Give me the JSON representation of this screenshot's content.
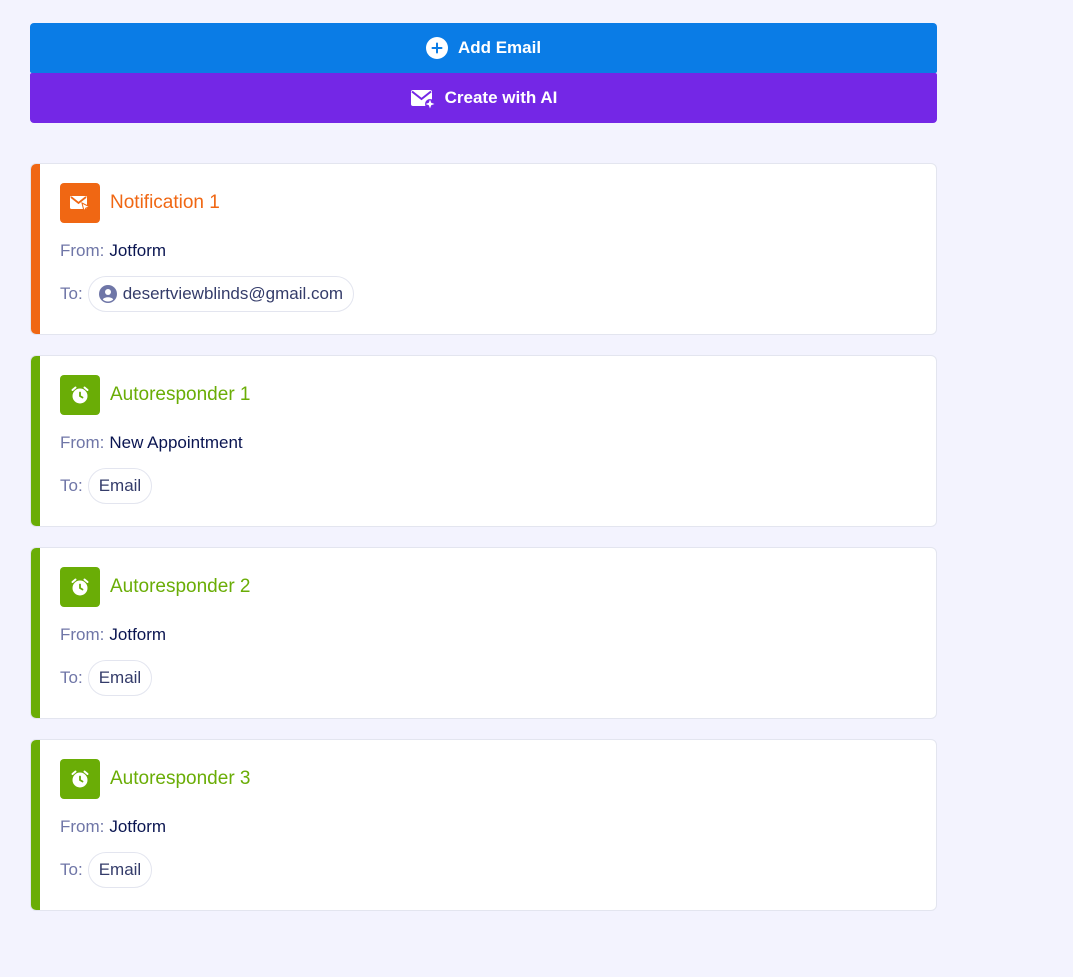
{
  "actions": {
    "add_email_label": "Add Email",
    "create_ai_label": "Create with AI",
    "add_email_icon": "plus-circle-icon",
    "create_ai_icon": "envelope-sparkle-icon"
  },
  "colors": {
    "add_email_bg": "#0a7ce6",
    "create_ai_bg": "#7427e6",
    "notification_accent": "#f06713",
    "autoresponder_accent": "#6aad06",
    "page_bg": "#f3f3fe"
  },
  "labels": {
    "from": "From:",
    "to": "To:"
  },
  "emails": [
    {
      "title": "Notification 1",
      "type": "notification",
      "icon": "envelope-bell-icon",
      "from": "Jotform",
      "to": "desertviewblinds@gmail.com",
      "to_icon": "user-circle-icon"
    },
    {
      "title": "Autoresponder 1",
      "type": "autoresponder",
      "icon": "alarm-clock-icon",
      "from": "New Appointment",
      "to": "Email"
    },
    {
      "title": "Autoresponder 2",
      "type": "autoresponder",
      "icon": "alarm-clock-icon",
      "from": "Jotform",
      "to": "Email"
    },
    {
      "title": "Autoresponder 3",
      "type": "autoresponder",
      "icon": "alarm-clock-icon",
      "from": "Jotform",
      "to": "Email"
    }
  ]
}
